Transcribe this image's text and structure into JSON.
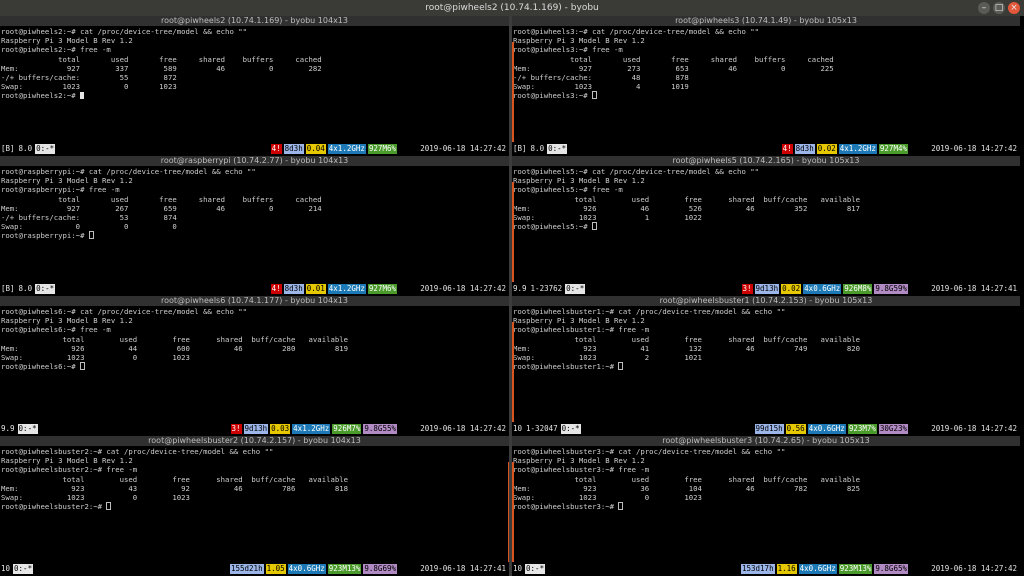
{
  "window": {
    "title": "root@piwheels2 (10.74.1.169) - byobu",
    "min_glyph": "–",
    "max_glyph": "□",
    "close_glyph": "×"
  },
  "panes": [
    {
      "title": "root@piwheels2 (10.74.1.169) - byobu 104x13",
      "prompt": "root@piwheels2:~#",
      "lines": [
        "root@piwheels2:~# cat /proc/device-tree/model && echo \"\"",
        "Raspberry Pi 3 Model B Rev 1.2",
        "root@piwheels2:~# free -m",
        "             total       used       free     shared    buffers     cached",
        "Mem:           927        337        589         46          0        282",
        "-/+ buffers/cache:         55        872",
        "Swap:         1023          0       1023"
      ],
      "status": {
        "logo": "[B]",
        "version": "8.0",
        "window": "0:-*",
        "cpu": "4!",
        "uptime": "8d3h",
        "load": "0.04",
        "freq": "4x1.2GHz",
        "mem": "927M6%",
        "disk": "",
        "datetime": "2019-06-18 14:27:42"
      }
    },
    {
      "title": "root@piwheels3 (10.74.1.49) - byobu 105x13",
      "prompt": "root@piwheels3:~#",
      "lines": [
        "root@piwheels3:~# cat /proc/device-tree/model && echo \"\"",
        "Raspberry Pi 3 Model B Rev 1.2",
        "root@piwheels3:~# free -m",
        "             total       used       free     shared    buffers     cached",
        "Mem:           927        273        653         46          0        225",
        "-/+ buffers/cache:         48        878",
        "Swap:         1023          4       1019"
      ],
      "status": {
        "logo": "[B]",
        "version": "8.0",
        "window": "0:-*",
        "cpu": "4!",
        "uptime": "8d3h",
        "load": "0.02",
        "freq": "4x1.2GHz",
        "mem": "927M4%",
        "disk": "",
        "datetime": "2019-06-18 14:27:42"
      }
    },
    {
      "title": "root@raspberrypi (10.74.2.77) - byobu 104x13",
      "prompt": "root@raspberrypi:~#",
      "lines": [
        "root@raspberrypi:~# cat /proc/device-tree/model && echo \"\"",
        "Raspberry Pi 3 Model B Rev 1.2",
        "root@raspberrypi:~# free -m",
        "             total       used       free     shared    buffers     cached",
        "Mem:           927        267        659         46          0        214",
        "-/+ buffers/cache:         53        874",
        "Swap:            0          0          0"
      ],
      "status": {
        "logo": "[B]",
        "version": "8.0",
        "window": "0:-*",
        "cpu": "4!",
        "uptime": "8d3h",
        "load": "0.01",
        "freq": "4x1.2GHz",
        "mem": "927M6%",
        "disk": "",
        "datetime": "2019-06-18 14:27:42"
      }
    },
    {
      "title": "root@piwheels5 (10.74.2.165) - byobu 105x13",
      "prompt": "root@piwheels5:~#",
      "lines": [
        "root@piwheels5:~# cat /proc/device-tree/model && echo \"\"",
        "Raspberry Pi 3 Model B Rev 1.2",
        "root@piwheels5:~# free -m",
        "              total        used        free      shared  buff/cache   available",
        "Mem:            926          46         526          46         352         817",
        "Swap:          1023           1        1022"
      ],
      "status": {
        "logo": "",
        "version": "9.9",
        "window": "1-23762",
        "window2": "0:-*",
        "cpu": "3!",
        "uptime": "9d13h",
        "load": "0.02",
        "freq": "4x0.6GHz",
        "mem": "926M8%",
        "disk": "9.8G59%",
        "datetime": "2019-06-18 14:27:41"
      }
    },
    {
      "title": "root@piwheels6 (10.74.1.177) - byobu 104x13",
      "prompt": "root@piwheels6:~#",
      "lines": [
        "root@piwheels6:~# cat /proc/device-tree/model && echo \"\"",
        "Raspberry Pi 3 Model B Rev 1.2",
        "root@piwheels6:~# free -m",
        "              total        used        free      shared  buff/cache   available",
        "Mem:            926          44         600          46         280         819",
        "Swap:          1023           0        1023"
      ],
      "status": {
        "logo": "",
        "version": "9.9",
        "window": "0:-*",
        "cpu": "3!",
        "uptime": "9d13h",
        "load": "0.03",
        "freq": "4x1.2GHz",
        "mem": "926M7%",
        "disk": "9.8G55%",
        "datetime": "2019-06-18 14:27:42"
      }
    },
    {
      "title": "root@piwheelsbuster1 (10.74.2.153) - byobu 105x13",
      "prompt": "root@piwheelsbuster1:~#",
      "lines": [
        "root@piwheelsbuster1:~# cat /proc/device-tree/model && echo \"\"",
        "Raspberry Pi 3 Model B Rev 1.2",
        "root@piwheelsbuster1:~# free -m",
        "              total        used        free      shared  buff/cache   available",
        "Mem:            923          41         132          46         749         820",
        "Swap:          1023           2        1021"
      ],
      "status": {
        "logo": "",
        "version": "10",
        "window": "1-32047",
        "window2": "0:-*",
        "cpu": "",
        "uptime": "99d15h",
        "load": "0.56",
        "freq": "4x0.6GHz",
        "mem": "923M7%",
        "disk": "30G23%",
        "datetime": "2019-06-18 14:27:42"
      }
    },
    {
      "title": "root@piwheelsbuster2 (10.74.2.157) - byobu 104x13",
      "prompt": "root@piwheelsbuster2:~#",
      "lines": [
        "root@piwheelsbuster2:~# cat /proc/device-tree/model && echo \"\"",
        "Raspberry Pi 3 Model B Rev 1.2",
        "root@piwheelsbuster2:~# free -m",
        "              total        used        free      shared  buff/cache   available",
        "Mem:            923          43          92          46         786         818",
        "Swap:          1023           0        1023"
      ],
      "status": {
        "logo": "",
        "version": "10",
        "window": "0:-*",
        "cpu": "",
        "uptime": "155d21h",
        "load": "1.05",
        "freq": "4x0.6GHz",
        "mem": "923M13%",
        "disk": "9.8G69%",
        "datetime": "2019-06-18 14:27:41"
      }
    },
    {
      "title": "root@piwheelsbuster3 (10.74.2.65) - byobu 105x13",
      "prompt": "root@piwheelsbuster3:~#",
      "lines": [
        "root@piwheelsbuster3:~# cat /proc/device-tree/model && echo \"\"",
        "Raspberry Pi 3 Model B Rev 1.2",
        "root@piwheelsbuster3:~# free -m",
        "              total        used        free      shared  buff/cache   available",
        "Mem:            923          36         104          46         782         825",
        "Swap:          1023           0        1023"
      ],
      "status": {
        "logo": "",
        "version": "10",
        "window": "0:-*",
        "cpu": "",
        "uptime": "153d17h",
        "load": "1.16",
        "freq": "4x0.6GHz",
        "mem": "923M13%",
        "disk": "9.8G65%",
        "datetime": "2019-06-18 14:27:42"
      }
    }
  ]
}
